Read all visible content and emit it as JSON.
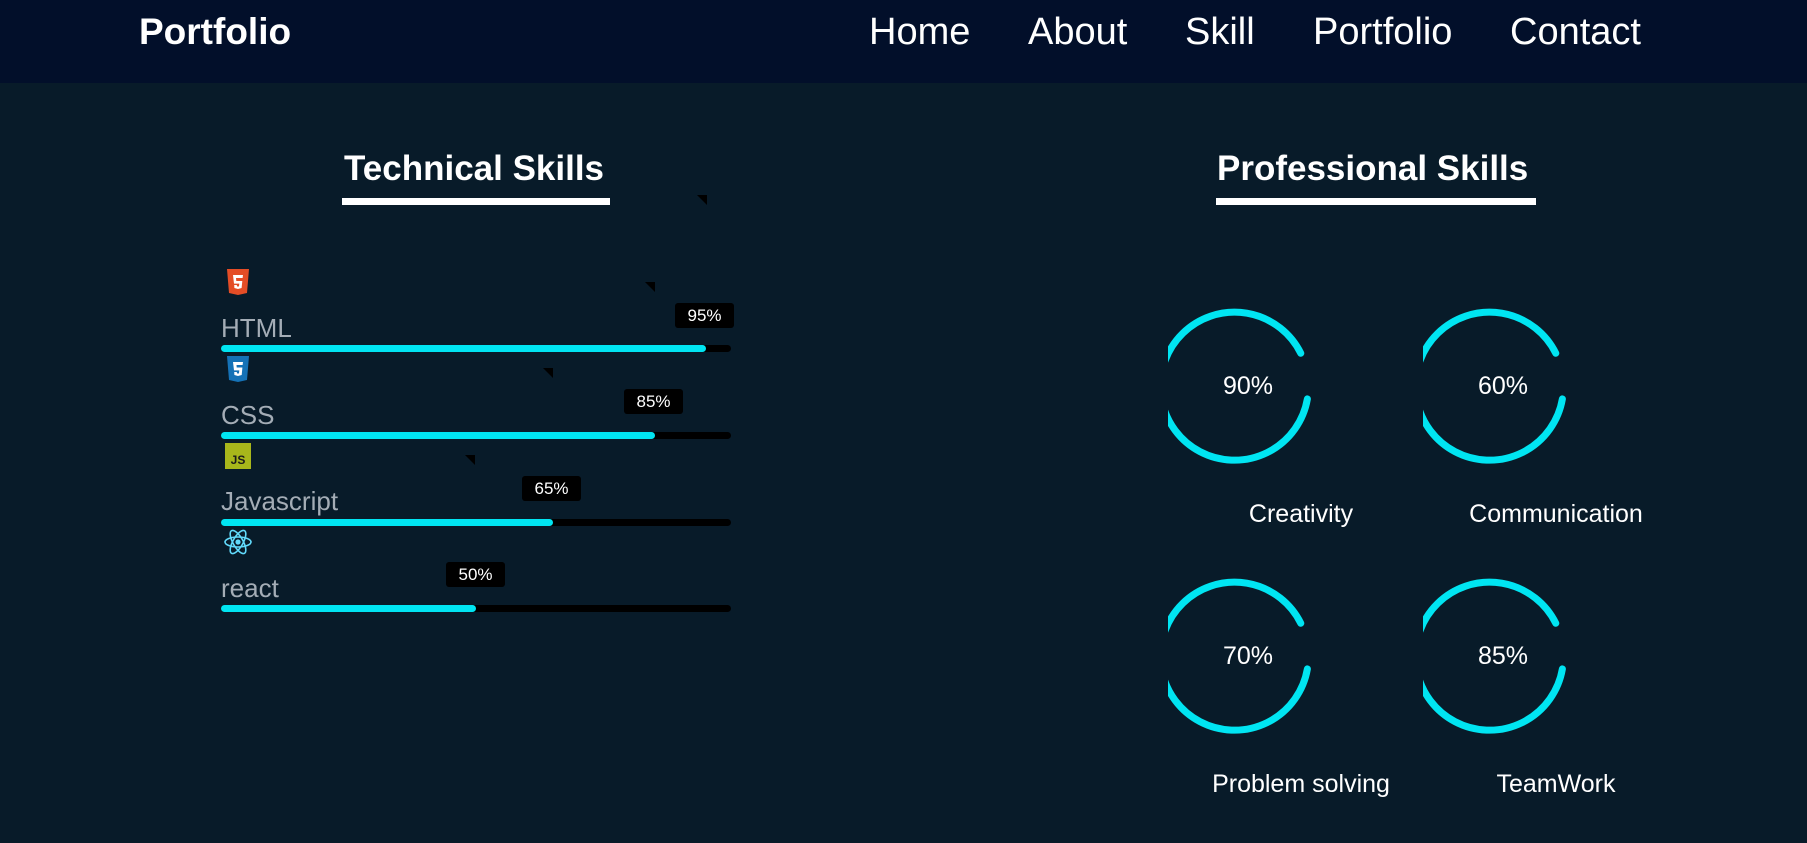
{
  "header": {
    "logo": "Portfolio",
    "nav": [
      "Home",
      "About",
      "Skill",
      "Portfolio",
      "Contact"
    ]
  },
  "technical": {
    "title": "Technical Skills",
    "skills": [
      {
        "name": "HTML",
        "percent_label": "95%",
        "level": 0.95,
        "icon": "html5-icon"
      },
      {
        "name": "CSS",
        "percent_label": "85%",
        "level": 0.85,
        "icon": "css3-icon"
      },
      {
        "name": "Javascript",
        "percent_label": "65%",
        "level": 0.65,
        "icon": "javascript-icon"
      },
      {
        "name": "react",
        "percent_label": "50%",
        "level": 0.5,
        "icon": "react-icon"
      }
    ]
  },
  "professional": {
    "title": "Professional Skills",
    "skills": [
      {
        "name": "Creativity",
        "percent_label": "90%"
      },
      {
        "name": "Communication",
        "percent_label": "60%"
      },
      {
        "name": "Problem solving",
        "percent_label": "70%"
      },
      {
        "name": "TeamWork",
        "percent_label": "85%"
      }
    ]
  },
  "colors": {
    "accent": "#00e5f2",
    "page_bg": "#081b29",
    "header_bg": "#020f2a",
    "html_icon": "#e44d26",
    "css_icon": "#1572b6",
    "js_icon": "#a8b71b",
    "react_icon": "#61dafb"
  }
}
